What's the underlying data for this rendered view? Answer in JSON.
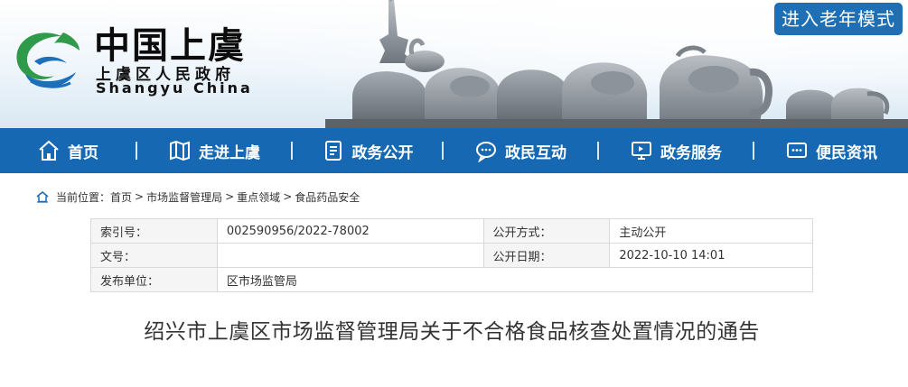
{
  "header": {
    "logo_cn": "中国上虞",
    "logo_sub": "上虞区人民政府",
    "logo_en": "Shangyu China",
    "elder_mode_button": "进入老年模式"
  },
  "nav": {
    "items": [
      {
        "label": "首页",
        "icon": "home-icon"
      },
      {
        "label": "走进上虞",
        "icon": "map-icon"
      },
      {
        "label": "政务公开",
        "icon": "document-icon"
      },
      {
        "label": "政民互动",
        "icon": "chat-icon"
      },
      {
        "label": "政务服务",
        "icon": "monitor-icon"
      },
      {
        "label": "便民资讯",
        "icon": "message-icon"
      }
    ]
  },
  "breadcrumb": {
    "prefix": "当前位置：",
    "items": [
      "首页",
      "市场监督管理局",
      "重点领域",
      "食品药品安全"
    ],
    "separator": ">"
  },
  "info": {
    "index_label": "索引号：",
    "index_value": "002590956/2022-78002",
    "method_label": "公开方式：",
    "method_value": "主动公开",
    "docno_label": "文号：",
    "docno_value": "",
    "date_label": "公开日期：",
    "date_value": "2022-10-10 14:01",
    "unit_label": "发布单位：",
    "unit_value": "区市场监管局"
  },
  "article": {
    "title": "绍兴市上虞区市场监督管理局关于不合格食品核查处置情况的通告"
  },
  "colors": {
    "nav_blue": "#1768b3",
    "button_blue": "#1f6fb5",
    "logo_green": "#2e9a4a",
    "logo_blue": "#1d6fb8"
  }
}
